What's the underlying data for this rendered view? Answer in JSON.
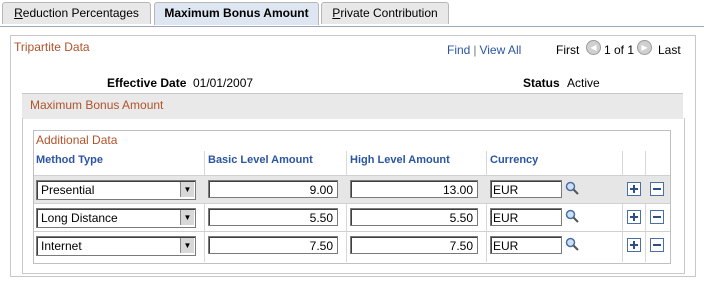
{
  "tabs": [
    {
      "label": "Reduction Percentages",
      "accel": "R",
      "rest": "eduction Percentages",
      "active": false
    },
    {
      "label": "Maximum Bonus Amount",
      "active": true
    },
    {
      "label": "Private Contribution",
      "accel": "P",
      "rest": "rivate Contribution",
      "active": false
    }
  ],
  "tripartite": {
    "title": "Tripartite Data",
    "find": "Find",
    "view_all": "View All",
    "first": "First",
    "page_info": "1 of 1",
    "last": "Last"
  },
  "effective_date": {
    "label": "Effective Date",
    "value": "01/01/2007"
  },
  "status": {
    "label": "Status",
    "value": "Active"
  },
  "max_bonus": {
    "title": "Maximum Bonus Amount"
  },
  "additional": {
    "title": "Additional Data",
    "columns": {
      "method_type": "Method Type",
      "basic_level": "Basic Level Amount",
      "high_level": "High Level Amount",
      "currency": "Currency"
    },
    "rows": [
      {
        "method": "Presential",
        "basic": "9.00",
        "high": "13.00",
        "currency": "EUR"
      },
      {
        "method": "Long Distance",
        "basic": "5.50",
        "high": "5.50",
        "currency": "EUR"
      },
      {
        "method": "Internet",
        "basic": "7.50",
        "high": "7.50",
        "currency": "EUR"
      }
    ]
  },
  "icons": {
    "lookup": "magnifier-icon",
    "add": "plus-icon",
    "delete": "minus-icon",
    "prev": "prev-arrow-icon",
    "next": "next-arrow-icon"
  },
  "colors": {
    "section_title": "#b0532a",
    "link": "#2b55a2",
    "active_tab": "#dde6f1"
  }
}
